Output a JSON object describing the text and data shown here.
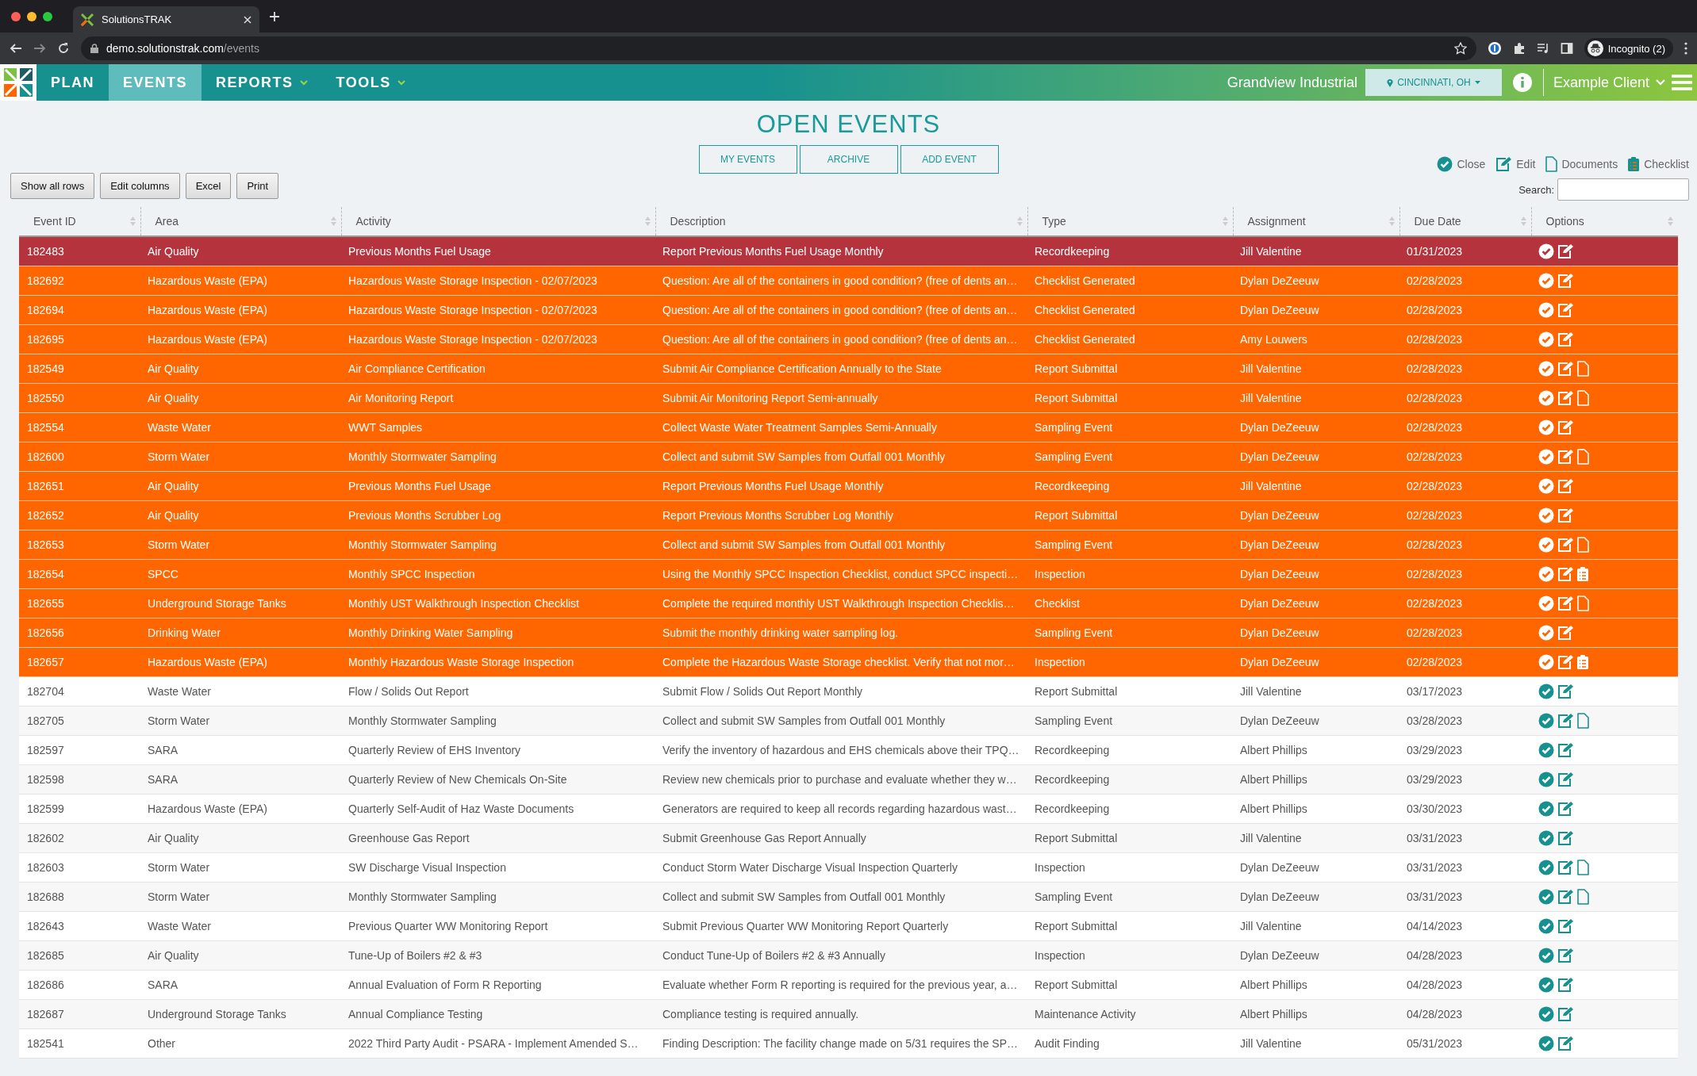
{
  "browser": {
    "tab_title": "SolutionsTRAK",
    "url_host": "demo.solutionstrak.com",
    "url_path": "/events",
    "profile": "Incognito (2)"
  },
  "nav": {
    "items": [
      {
        "label": "PLAN",
        "selected": false,
        "dropdown": false
      },
      {
        "label": "EVENTS",
        "selected": true,
        "dropdown": false
      },
      {
        "label": "REPORTS",
        "selected": false,
        "dropdown": true
      },
      {
        "label": "TOOLS",
        "selected": false,
        "dropdown": true
      }
    ],
    "facility": "Grandview Industrial",
    "location": "CINCINNATI, OH",
    "client": "Example Client"
  },
  "title": "OPEN EVENTS",
  "view_buttons": [
    "MY EVENTS",
    "ARCHIVE",
    "ADD EVENT"
  ],
  "legend": [
    {
      "kind": "close",
      "label": "Close"
    },
    {
      "kind": "edit",
      "label": "Edit"
    },
    {
      "kind": "document",
      "label": "Documents"
    },
    {
      "kind": "checklist",
      "label": "Checklist"
    }
  ],
  "table_buttons": [
    "Show all rows",
    "Edit columns",
    "Excel",
    "Print"
  ],
  "search": {
    "label": "Search:"
  },
  "table": {
    "columns": [
      "Event ID",
      "Area",
      "Activity",
      "Description",
      "Type",
      "Assignment",
      "Due Date",
      "Options"
    ],
    "rows": [
      {
        "id": "182483",
        "area": "Air Quality",
        "activity": "Previous Months Fuel Usage",
        "description": "Report Previous Months Fuel Usage Monthly",
        "type": "Recordkeeping",
        "assignment": "Jill Valentine",
        "due": "01/31/2023",
        "kind": "overdue",
        "actions": [
          {
            "kind": "close"
          },
          {
            "kind": "edit"
          }
        ]
      },
      {
        "id": "182692",
        "area": "Hazardous Waste (EPA)",
        "activity": "Hazardous Waste Storage Inspection - 02/07/2023",
        "description": "Question: Are all of the containers in good condition? (free of dents an…",
        "type": "Checklist Generated",
        "assignment": "Dylan DeZeeuw",
        "due": "02/28/2023",
        "kind": "due",
        "actions": [
          {
            "kind": "close"
          },
          {
            "kind": "edit"
          }
        ]
      },
      {
        "id": "182694",
        "area": "Hazardous Waste (EPA)",
        "activity": "Hazardous Waste Storage Inspection - 02/07/2023",
        "description": "Question: Are all of the containers in good condition? (free of dents an…",
        "type": "Checklist Generated",
        "assignment": "Dylan DeZeeuw",
        "due": "02/28/2023",
        "kind": "due",
        "actions": [
          {
            "kind": "close"
          },
          {
            "kind": "edit"
          }
        ]
      },
      {
        "id": "182695",
        "area": "Hazardous Waste (EPA)",
        "activity": "Hazardous Waste Storage Inspection - 02/07/2023",
        "description": "Question: Are all of the containers in good condition? (free of dents an…",
        "type": "Checklist Generated",
        "assignment": "Amy Louwers",
        "due": "02/28/2023",
        "kind": "due",
        "actions": [
          {
            "kind": "close"
          },
          {
            "kind": "edit"
          }
        ]
      },
      {
        "id": "182549",
        "area": "Air Quality",
        "activity": "Air Compliance Certification",
        "description": "Submit Air Compliance Certification Annually to the State",
        "type": "Report Submittal",
        "assignment": "Jill Valentine",
        "due": "02/28/2023",
        "kind": "due",
        "actions": [
          {
            "kind": "close"
          },
          {
            "kind": "edit"
          },
          {
            "kind": "document"
          }
        ]
      },
      {
        "id": "182550",
        "area": "Air Quality",
        "activity": "Air Monitoring Report",
        "description": "Submit Air Monitoring Report Semi-annually",
        "type": "Report Submittal",
        "assignment": "Jill Valentine",
        "due": "02/28/2023",
        "kind": "due",
        "actions": [
          {
            "kind": "close"
          },
          {
            "kind": "edit"
          },
          {
            "kind": "document"
          }
        ]
      },
      {
        "id": "182554",
        "area": "Waste Water",
        "activity": "WWT Samples",
        "description": "Collect Waste Water Treatment Samples Semi-Annually",
        "type": "Sampling Event",
        "assignment": "Dylan DeZeeuw",
        "due": "02/28/2023",
        "kind": "due",
        "actions": [
          {
            "kind": "close"
          },
          {
            "kind": "edit"
          }
        ]
      },
      {
        "id": "182600",
        "area": "Storm Water",
        "activity": "Monthly Stormwater Sampling",
        "description": "Collect and submit SW Samples from Outfall 001 Monthly",
        "type": "Sampling Event",
        "assignment": "Dylan DeZeeuw",
        "due": "02/28/2023",
        "kind": "due",
        "actions": [
          {
            "kind": "close"
          },
          {
            "kind": "edit"
          },
          {
            "kind": "document"
          }
        ]
      },
      {
        "id": "182651",
        "area": "Air Quality",
        "activity": "Previous Months Fuel Usage",
        "description": "Report Previous Months Fuel Usage Monthly",
        "type": "Recordkeeping",
        "assignment": "Jill Valentine",
        "due": "02/28/2023",
        "kind": "due",
        "actions": [
          {
            "kind": "close"
          },
          {
            "kind": "edit"
          }
        ]
      },
      {
        "id": "182652",
        "area": "Air Quality",
        "activity": "Previous Months Scrubber Log",
        "description": "Report Previous Months Scrubber Log Monthly",
        "type": "Report Submittal",
        "assignment": "Dylan DeZeeuw",
        "due": "02/28/2023",
        "kind": "due",
        "actions": [
          {
            "kind": "close"
          },
          {
            "kind": "edit"
          }
        ]
      },
      {
        "id": "182653",
        "area": "Storm Water",
        "activity": "Monthly Stormwater Sampling",
        "description": "Collect and submit SW Samples from Outfall 001 Monthly",
        "type": "Sampling Event",
        "assignment": "Dylan DeZeeuw",
        "due": "02/28/2023",
        "kind": "due",
        "actions": [
          {
            "kind": "close"
          },
          {
            "kind": "edit"
          },
          {
            "kind": "document"
          }
        ]
      },
      {
        "id": "182654",
        "area": "SPCC",
        "activity": "Monthly SPCC Inspection",
        "description": "Using the Monthly SPCC Inspection Checklist, conduct SPCC inspecti…",
        "type": "Inspection",
        "assignment": "Dylan DeZeeuw",
        "due": "02/28/2023",
        "kind": "due",
        "actions": [
          {
            "kind": "close"
          },
          {
            "kind": "edit"
          },
          {
            "kind": "checklist"
          }
        ]
      },
      {
        "id": "182655",
        "area": "Underground Storage Tanks",
        "activity": "Monthly UST Walkthrough Inspection Checklist",
        "description": "Complete the required monthly UST Walkthrough Inspection Checklis…",
        "type": "Checklist",
        "assignment": "Dylan DeZeeuw",
        "due": "02/28/2023",
        "kind": "due",
        "actions": [
          {
            "kind": "close"
          },
          {
            "kind": "edit"
          },
          {
            "kind": "document"
          }
        ]
      },
      {
        "id": "182656",
        "area": "Drinking Water",
        "activity": "Monthly Drinking Water Sampling",
        "description": "Submit the monthly drinking water sampling log.",
        "type": "Sampling Event",
        "assignment": "Dylan DeZeeuw",
        "due": "02/28/2023",
        "kind": "due",
        "actions": [
          {
            "kind": "close"
          },
          {
            "kind": "edit"
          }
        ]
      },
      {
        "id": "182657",
        "area": "Hazardous Waste (EPA)",
        "activity": "Monthly Hazardous Waste Storage Inspection",
        "description": "Complete the Hazardous Waste Storage checklist. Verify that not mor…",
        "type": "Inspection",
        "assignment": "Dylan DeZeeuw",
        "due": "02/28/2023",
        "kind": "due",
        "actions": [
          {
            "kind": "close"
          },
          {
            "kind": "edit"
          },
          {
            "kind": "checklist"
          }
        ]
      },
      {
        "id": "182704",
        "area": "Waste Water",
        "activity": "Flow / Solids Out Report",
        "description": "Submit Flow / Solids Out Report Monthly",
        "type": "Report Submittal",
        "assignment": "Jill Valentine",
        "due": "03/17/2023",
        "kind": "upcoming",
        "actions": [
          {
            "kind": "close"
          },
          {
            "kind": "edit"
          }
        ]
      },
      {
        "id": "182705",
        "area": "Storm Water",
        "activity": "Monthly Stormwater Sampling",
        "description": "Collect and submit SW Samples from Outfall 001 Monthly",
        "type": "Sampling Event",
        "assignment": "Dylan DeZeeuw",
        "due": "03/28/2023",
        "kind": "upcoming",
        "actions": [
          {
            "kind": "close"
          },
          {
            "kind": "edit"
          },
          {
            "kind": "document"
          }
        ]
      },
      {
        "id": "182597",
        "area": "SARA",
        "activity": "Quarterly Review of EHS Inventory",
        "description": "Verify the inventory of hazardous and EHS chemicals above their TPQ…",
        "type": "Recordkeeping",
        "assignment": "Albert Phillips",
        "due": "03/29/2023",
        "kind": "upcoming",
        "actions": [
          {
            "kind": "close"
          },
          {
            "kind": "edit"
          }
        ]
      },
      {
        "id": "182598",
        "area": "SARA",
        "activity": "Quarterly Review of New Chemicals On-Site",
        "description": "Review new chemicals prior to purchase and evaluate whether they w…",
        "type": "Recordkeeping",
        "assignment": "Albert Phillips",
        "due": "03/29/2023",
        "kind": "upcoming",
        "actions": [
          {
            "kind": "close"
          },
          {
            "kind": "edit"
          }
        ]
      },
      {
        "id": "182599",
        "area": "Hazardous Waste (EPA)",
        "activity": "Quarterly Self-Audit of Haz Waste Documents",
        "description": "Generators are required to keep all records regarding hazardous wast…",
        "type": "Recordkeeping",
        "assignment": "Albert Phillips",
        "due": "03/30/2023",
        "kind": "upcoming",
        "actions": [
          {
            "kind": "close"
          },
          {
            "kind": "edit"
          }
        ]
      },
      {
        "id": "182602",
        "area": "Air Quality",
        "activity": "Greenhouse Gas Report",
        "description": "Submit Greenhouse Gas Report Annually",
        "type": "Report Submittal",
        "assignment": "Jill Valentine",
        "due": "03/31/2023",
        "kind": "upcoming",
        "actions": [
          {
            "kind": "close"
          },
          {
            "kind": "edit"
          }
        ]
      },
      {
        "id": "182603",
        "area": "Storm Water",
        "activity": "SW Discharge Visual Inspection",
        "description": "Conduct Storm Water Discharge Visual Inspection Quarterly",
        "type": "Inspection",
        "assignment": "Dylan DeZeeuw",
        "due": "03/31/2023",
        "kind": "upcoming",
        "actions": [
          {
            "kind": "close"
          },
          {
            "kind": "edit"
          },
          {
            "kind": "document"
          }
        ]
      },
      {
        "id": "182688",
        "area": "Storm Water",
        "activity": "Monthly Stormwater Sampling",
        "description": "Collect and submit SW Samples from Outfall 001 Monthly",
        "type": "Sampling Event",
        "assignment": "Dylan DeZeeuw",
        "due": "03/31/2023",
        "kind": "upcoming",
        "actions": [
          {
            "kind": "close"
          },
          {
            "kind": "edit"
          },
          {
            "kind": "document"
          }
        ]
      },
      {
        "id": "182643",
        "area": "Waste Water",
        "activity": "Previous Quarter WW Monitoring Report",
        "description": "Submit Previous Quarter WW Monitoring Report Quarterly",
        "type": "Report Submittal",
        "assignment": "Jill Valentine",
        "due": "04/14/2023",
        "kind": "upcoming",
        "actions": [
          {
            "kind": "close"
          },
          {
            "kind": "edit"
          }
        ]
      },
      {
        "id": "182685",
        "area": "Air Quality",
        "activity": "Tune-Up of Boilers #2 & #3",
        "description": "Conduct Tune-Up of Boilers #2 & #3 Annually",
        "type": "Inspection",
        "assignment": "Dylan DeZeeuw",
        "due": "04/28/2023",
        "kind": "upcoming",
        "actions": [
          {
            "kind": "close"
          },
          {
            "kind": "edit"
          }
        ]
      },
      {
        "id": "182686",
        "area": "SARA",
        "activity": "Annual Evaluation of Form R Reporting",
        "description": "Evaluate whether Form R reporting is required for the previous year, a…",
        "type": "Report Submittal",
        "assignment": "Albert Phillips",
        "due": "04/28/2023",
        "kind": "upcoming",
        "actions": [
          {
            "kind": "close"
          },
          {
            "kind": "edit"
          }
        ]
      },
      {
        "id": "182687",
        "area": "Underground Storage Tanks",
        "activity": "Annual Compliance Testing",
        "description": "Compliance testing is required annually.",
        "type": "Maintenance Activity",
        "assignment": "Albert Phillips",
        "due": "04/28/2023",
        "kind": "upcoming",
        "actions": [
          {
            "kind": "close"
          },
          {
            "kind": "edit"
          }
        ]
      },
      {
        "id": "182541",
        "area": "Other",
        "activity": "2022 Third Party Audit - PSARA - Implement Amended S…",
        "description": "Finding Description: The facility change made on 5/31 requires the SP…",
        "type": "Audit Finding",
        "assignment": "Jill Valentine",
        "due": "05/31/2023",
        "kind": "upcoming",
        "actions": [
          {
            "kind": "close"
          },
          {
            "kind": "edit"
          }
        ]
      }
    ]
  }
}
